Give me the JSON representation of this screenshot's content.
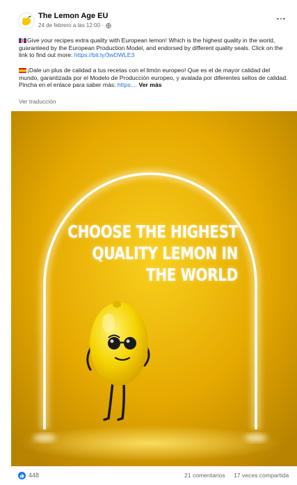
{
  "post": {
    "page_name": "The Lemon Age EU",
    "date": "24 de febrero a las 12:00 ·",
    "paragraph_en": {
      "text": "Give your recipes extra quality with European lemon! Which is the highest quality in the world, guaranteed by the European Production Model, and endorsed by different quality seals. Click on the link to find out more: ",
      "link": "https://bit.ly/3wDWLE3"
    },
    "paragraph_es": {
      "text": "¡Dale un plus de calidad a tus recetas con el limón europeo! Que es el de mayor calidad del mundo, garantizada por el Modelo de Producción europeo, y avalada por diferentes sellos de calidad. Pincha en el enlace para saber más: ",
      "link": "https:...",
      "see_more": "Ver más"
    },
    "see_translation": "Ver traducción",
    "image": {
      "headline_lines": [
        "CHOOSE THE HIGHEST",
        "QUALITY LEMON IN",
        "THE WORLD"
      ]
    },
    "stats": {
      "reactions": "448",
      "comments": "21 comentarios",
      "shares": "17 veces compartida"
    }
  },
  "colors": {
    "link": "#216fdb",
    "like_blue": "#1877f2",
    "secondary_text": "#65676b",
    "image_yellow": "#f5c518"
  },
  "icons": {
    "more": "more-options-icon",
    "privacy": "globe-icon",
    "reaction": "like-icon"
  }
}
